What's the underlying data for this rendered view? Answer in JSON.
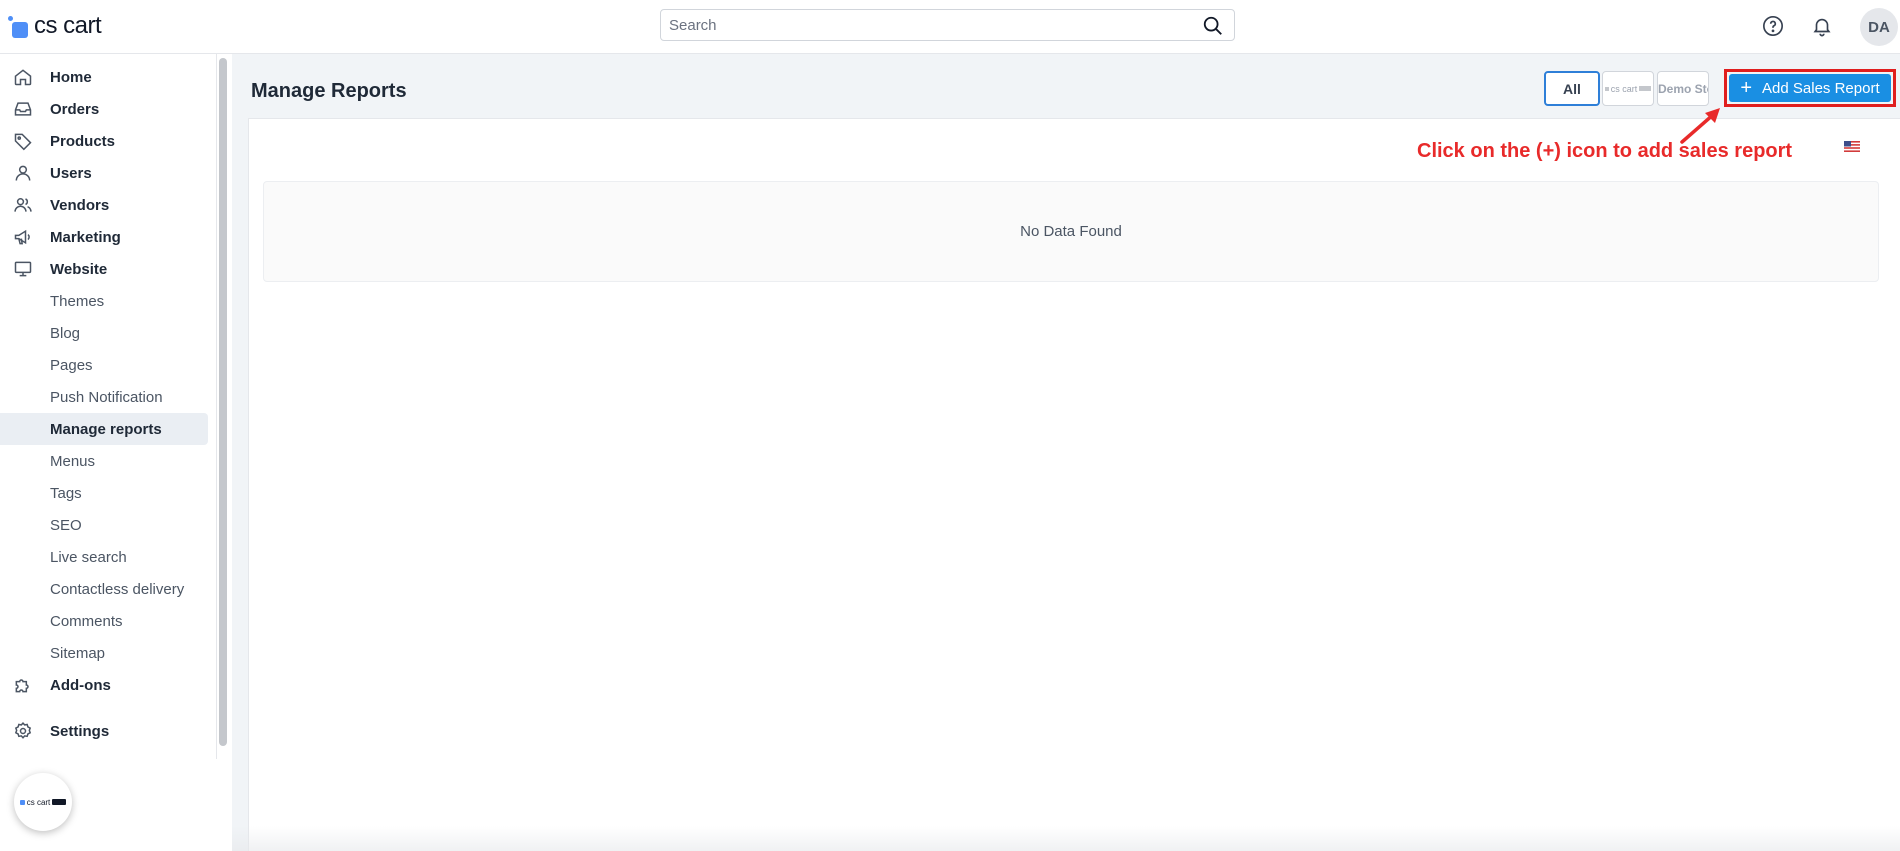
{
  "app": {
    "logo_text": "cs cart"
  },
  "header": {
    "search_placeholder": "Search",
    "icons": [
      "help-icon",
      "bell-icon"
    ],
    "avatar_initials": "DA"
  },
  "sidebar": {
    "main_items": [
      {
        "label": "Home",
        "icon": "home-icon"
      },
      {
        "label": "Orders",
        "icon": "inbox-icon"
      },
      {
        "label": "Products",
        "icon": "tag-icon"
      },
      {
        "label": "Users",
        "icon": "user-icon"
      },
      {
        "label": "Vendors",
        "icon": "users-icon"
      },
      {
        "label": "Marketing",
        "icon": "megaphone-icon"
      },
      {
        "label": "Website",
        "icon": "monitor-icon"
      }
    ],
    "website_subitems": [
      "Themes",
      "Blog",
      "Pages",
      "Push Notification",
      "Manage reports",
      "Menus",
      "Tags",
      "SEO",
      "Live search",
      "Contactless delivery",
      "Comments",
      "Sitemap"
    ],
    "active_subitem": "Manage reports",
    "bottom_items": [
      {
        "label": "Add-ons",
        "icon": "puzzle-icon"
      },
      {
        "label": "Settings",
        "icon": "gear-icon"
      }
    ]
  },
  "page": {
    "title": "Manage Reports",
    "storefront_filter": {
      "all_label": "All",
      "stores": [
        "cs cart",
        "Demo Store"
      ]
    },
    "add_button_label": "Add Sales Report",
    "annotation": "Click on the (+) icon to add sales report",
    "empty_message": "No Data Found"
  },
  "colors": {
    "primary": "#1a8fe3",
    "annotation": "#e82a2a",
    "active_nav_bg": "#eaeef3",
    "main_bg": "#f1f4f7"
  }
}
